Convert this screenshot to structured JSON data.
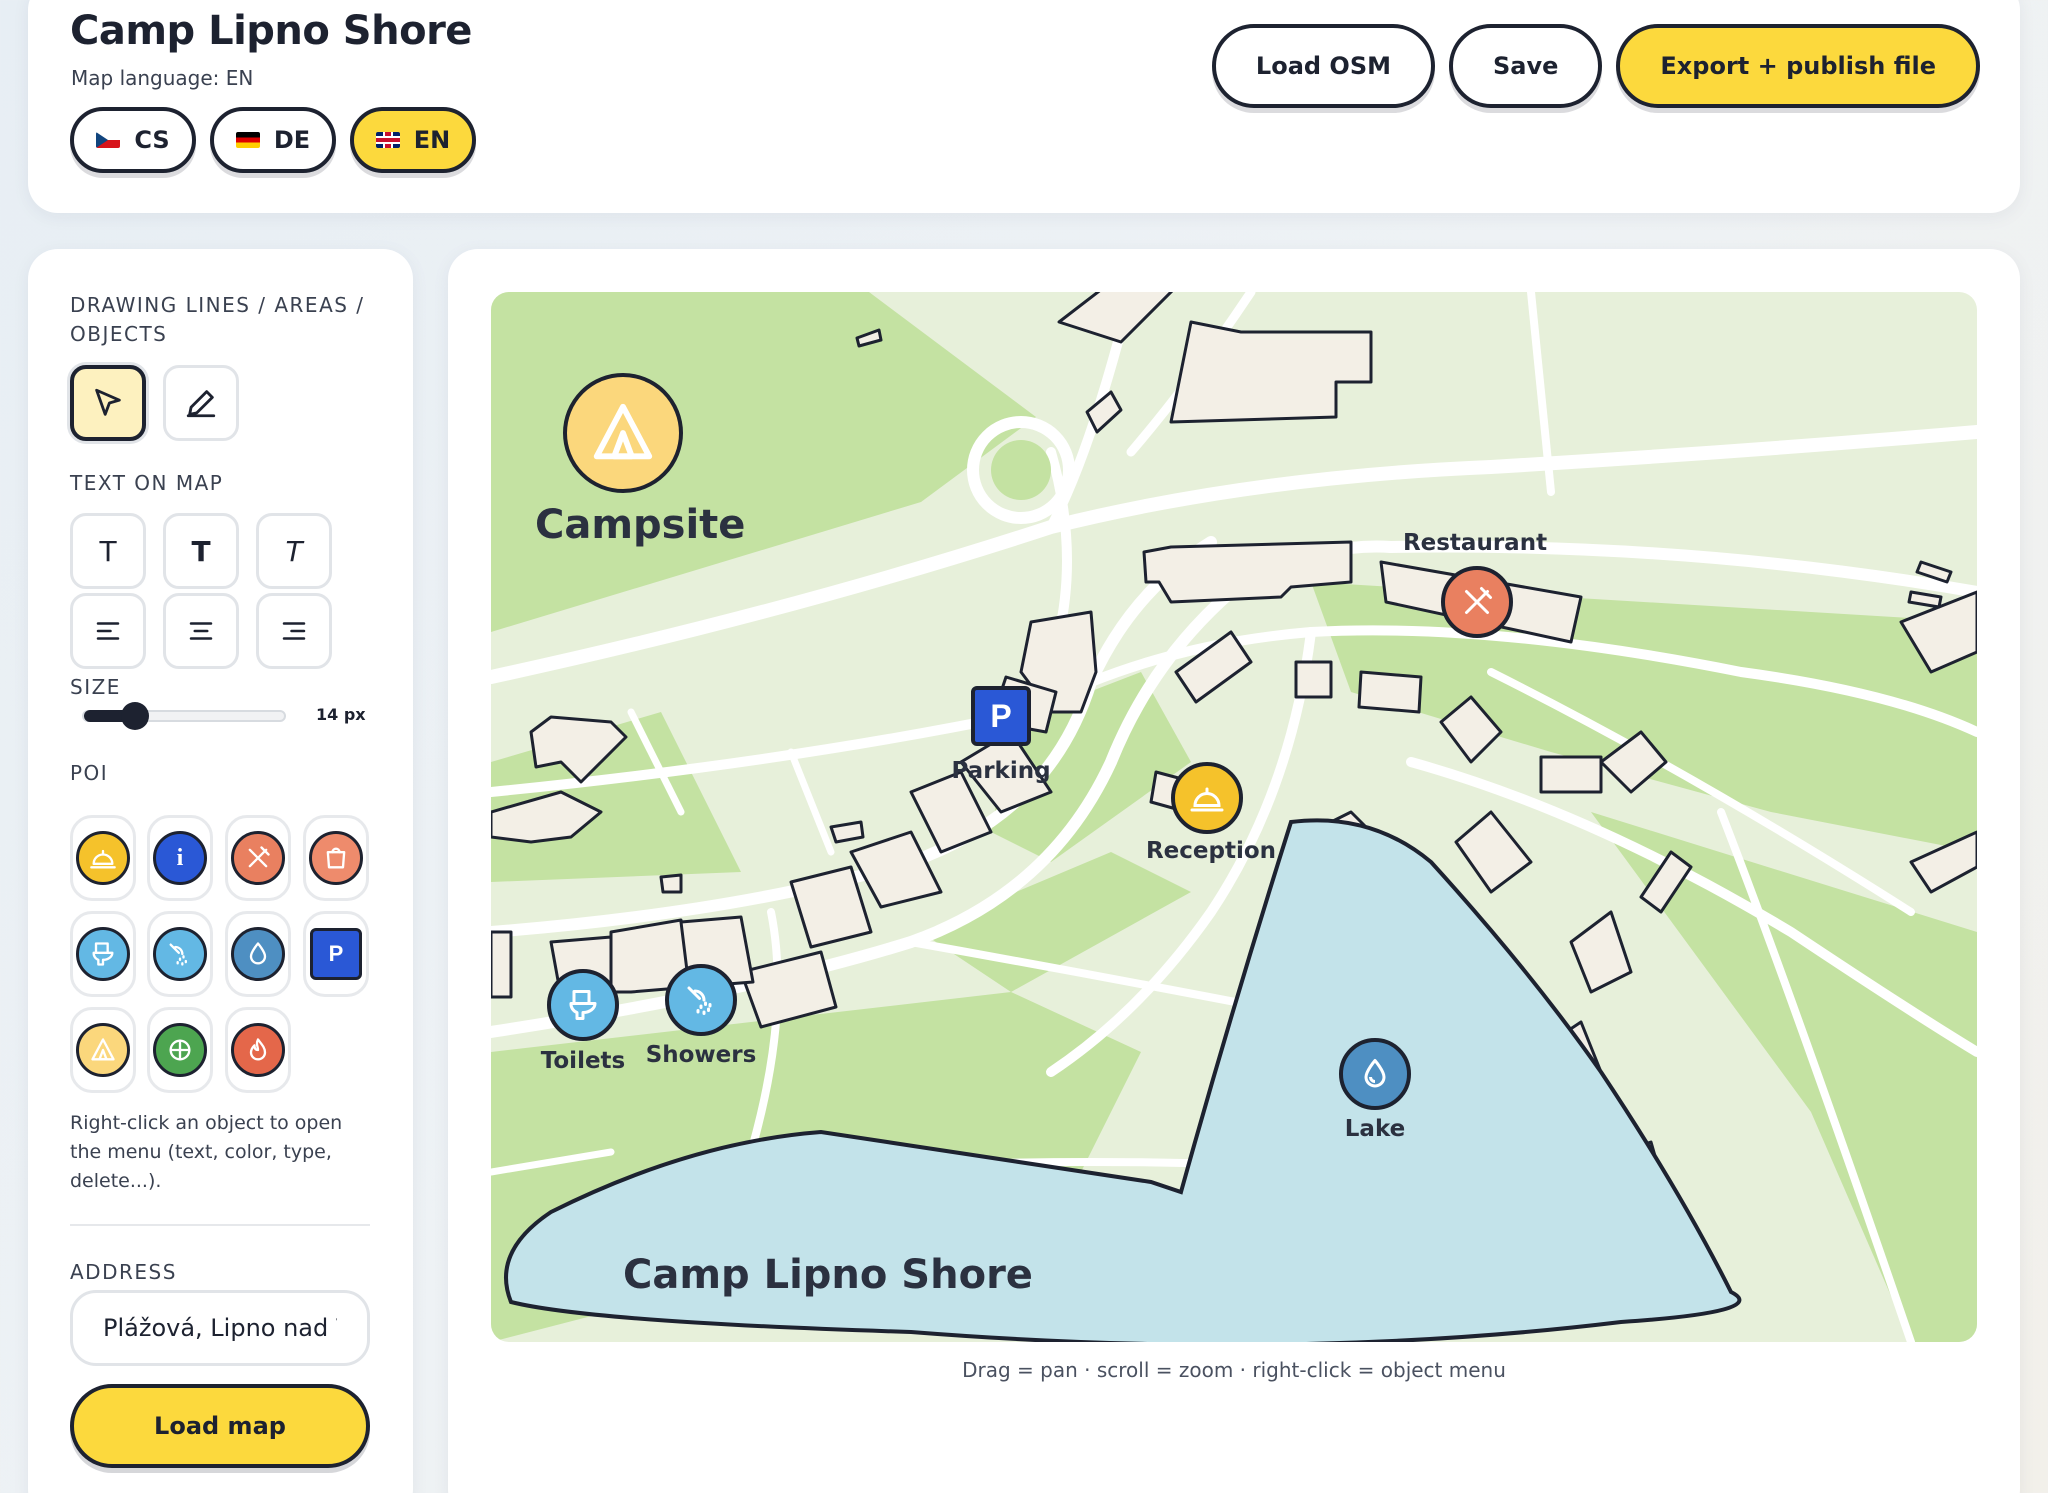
{
  "header": {
    "title": "Camp Lipno Shore",
    "language_caption": "Map language: EN",
    "languages": [
      {
        "code": "CS",
        "flag": "flag-cz-icon",
        "active": false
      },
      {
        "code": "DE",
        "flag": "flag-de-icon",
        "active": false
      },
      {
        "code": "EN",
        "flag": "flag-gb-icon",
        "active": true
      }
    ],
    "actions": {
      "load_osm": "Load OSM",
      "save": "Save",
      "export": "Export + publish file"
    }
  },
  "sidebar": {
    "drawing_label": "DRAWING LINES / AREAS / OBJECTS",
    "drawing_tools": [
      {
        "icon": "cursor-arrow-icon",
        "active": true
      },
      {
        "icon": "pencil-icon",
        "active": false
      }
    ],
    "text_label": "TEXT ON MAP",
    "text_styles": [
      "T",
      "T",
      "T"
    ],
    "text_align_icons": [
      "align-left-icon",
      "align-center-icon",
      "align-right-icon"
    ],
    "size_label": "SIZE",
    "size_value": "14 px",
    "size_fraction": 0.25,
    "poi_label": "POI",
    "poi_icons": [
      {
        "name": "reception-bell-icon",
        "color": "#f5c22b"
      },
      {
        "name": "info-icon",
        "color": "#2a58d6",
        "glyph": "i"
      },
      {
        "name": "restaurant-icon",
        "color": "#e98060"
      },
      {
        "name": "shop-icon",
        "color": "#ee8b6c"
      },
      {
        "name": "toilet-icon",
        "color": "#63b8e4"
      },
      {
        "name": "shower-icon",
        "color": "#63b8e4"
      },
      {
        "name": "water-drop-icon",
        "color": "#4e8fc2"
      },
      {
        "name": "parking-icon",
        "color": "#2a58d6",
        "glyph": "P"
      },
      {
        "name": "tent-icon",
        "color": "#fbd77c"
      },
      {
        "name": "playground-icon",
        "color": "#4da550"
      },
      {
        "name": "fire-icon",
        "color": "#e4674a"
      }
    ],
    "hint": "Right-click an object to open the menu (text, color, type, delete...).",
    "address_label": "ADDRESS",
    "address_value": "Plážová, Lipno nad V",
    "load_map": "Load map"
  },
  "map": {
    "campsite_label": "Campsite",
    "lake_title": "Camp Lipno Shore",
    "markers": [
      {
        "label": "Restaurant",
        "icon": "restaurant-icon",
        "color": "#e98060"
      },
      {
        "label": "Parking",
        "icon": "parking-icon",
        "color": "#2a58d6",
        "glyph": "P"
      },
      {
        "label": "Reception",
        "icon": "reception-bell-icon",
        "color": "#f5c22b"
      },
      {
        "label": "Toilets",
        "icon": "toilet-icon",
        "color": "#63b8e4"
      },
      {
        "label": "Showers",
        "icon": "shower-icon",
        "color": "#63b8e4"
      },
      {
        "label": "Lake",
        "icon": "water-drop-icon",
        "color": "#4e8fc2"
      }
    ],
    "footer": "Drag = pan · scroll = zoom · right-click = object menu",
    "colors": {
      "land": "#e7f0da",
      "park": "#c4e2a2",
      "water": "#c3e3ea",
      "building": "#f3efe6",
      "outline": "#1d2230"
    }
  }
}
